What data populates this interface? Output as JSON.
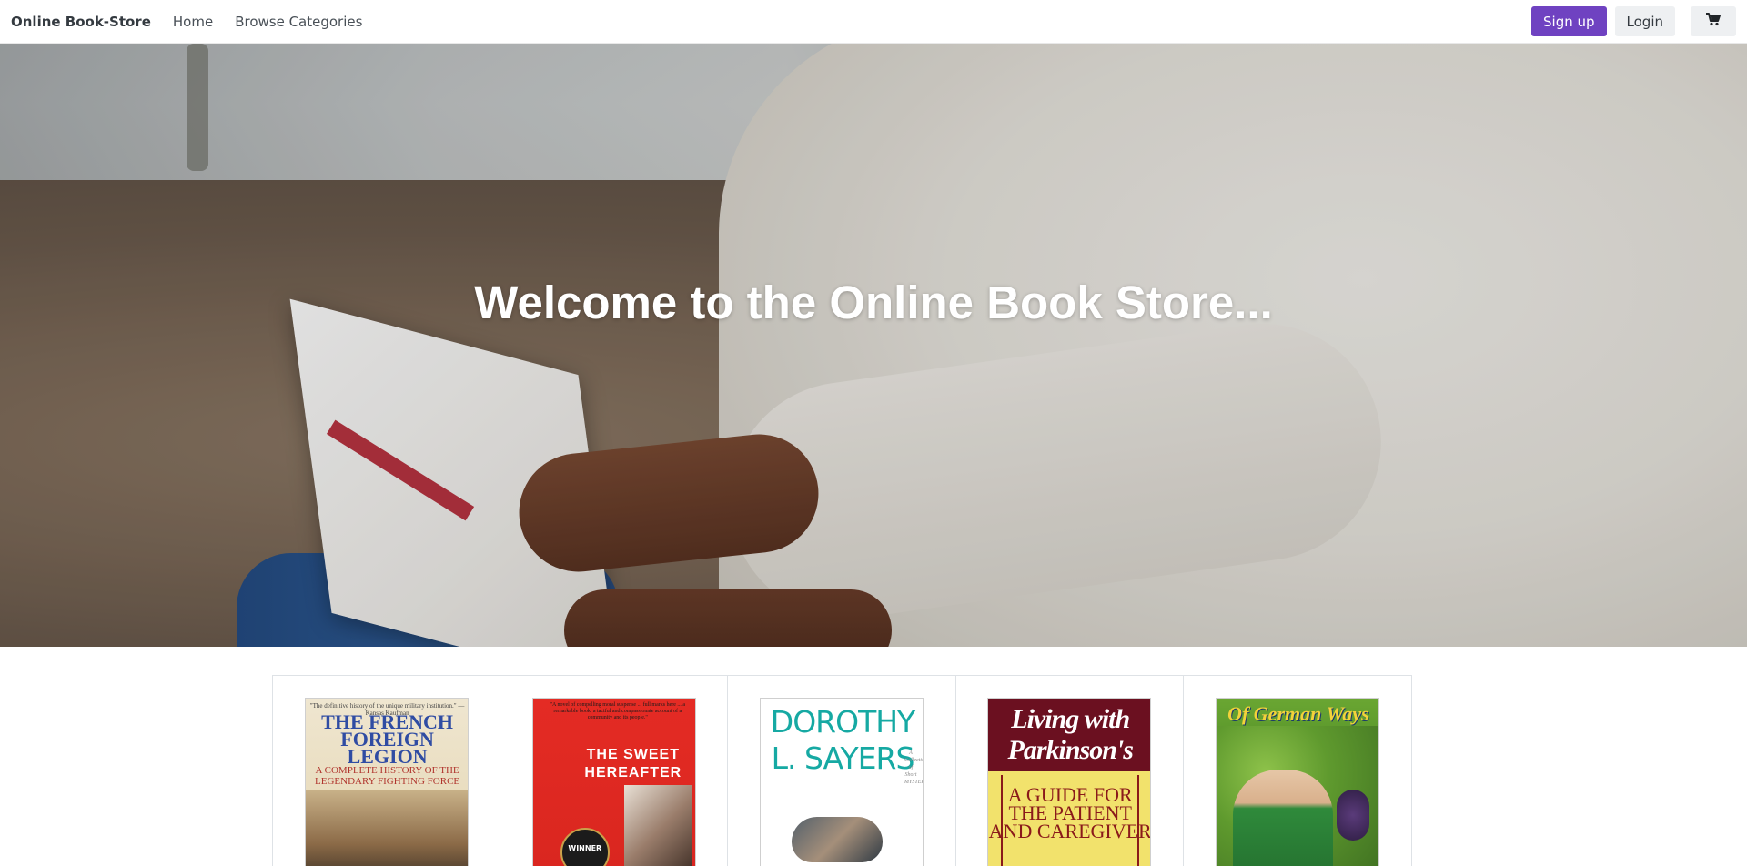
{
  "navbar": {
    "brand": "Online Book-Store",
    "links": [
      {
        "label": "Home"
      },
      {
        "label": "Browse Categories"
      }
    ],
    "signup_label": "Sign up",
    "login_label": "Login",
    "cart_icon": "shopping-cart-icon"
  },
  "hero": {
    "title": "Welcome to the Online Book Store..."
  },
  "books": [
    {
      "cover_text": {
        "head": "\"The definitive history of the unique military institution.\" — Kansas Kaufman",
        "title": "THE FRENCH FOREIGN LEGION",
        "subtitle": "A COMPLETE HISTORY OF THE LEGENDARY FIGHTING FORCE"
      }
    },
    {
      "cover_text": {
        "blurb": "\"A novel of compelling moral suspense ... full marks here ... a remarkable book, a tactful and compassionate account of a community and its people.\"",
        "title": "THE SWEET HEREAFTER",
        "badge": "WINNER"
      }
    },
    {
      "cover_text": {
        "title": "DOROTHY L. SAYERS",
        "side": "A Collection of Short MYSTERIES"
      }
    },
    {
      "cover_text": {
        "title": "Living with Parkinson's",
        "subtitle": "A GUIDE FOR THE PATIENT AND CAREGIVER"
      }
    },
    {
      "cover_text": {
        "title": "Of German Ways"
      }
    }
  ],
  "colors": {
    "accent": "#6f42c1",
    "nav_border": "#e8e8e8",
    "grid_border": "#dee2e6"
  }
}
